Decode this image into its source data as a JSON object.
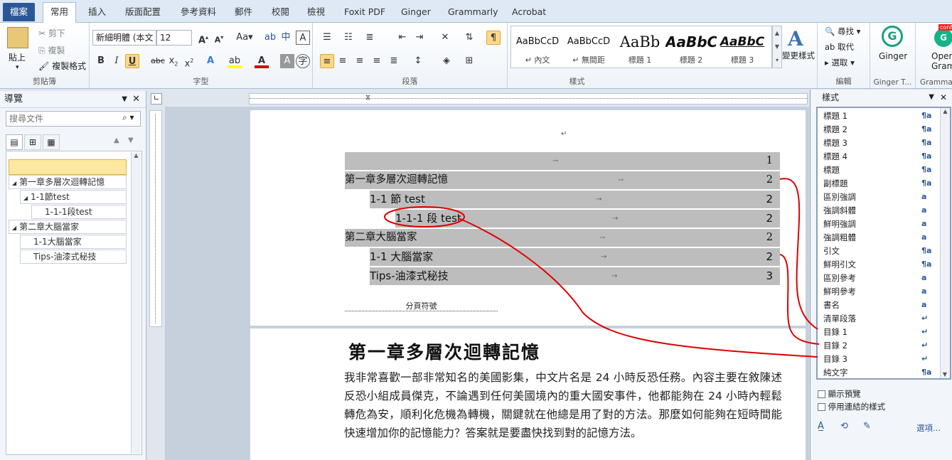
{
  "tabs": [
    "檔案",
    "常用",
    "插入",
    "版面配置",
    "參考資料",
    "郵件",
    "校閱",
    "檢視",
    "Foxit PDF",
    "Ginger",
    "Grammarly",
    "Acrobat"
  ],
  "ribbon": {
    "clipboard": {
      "paste": "貼上",
      "cut": "剪下",
      "copy": "複製",
      "format_painter": "複製格式",
      "label": "剪貼簿"
    },
    "font": {
      "name": "新細明體 (本文",
      "size": "12",
      "label": "字型"
    },
    "paragraph": {
      "label": "段落"
    },
    "styles": {
      "items": [
        {
          "preview": "AaBbCcD",
          "name": "↵ 內文"
        },
        {
          "preview": "AaBbCcD",
          "name": "↵ 無間距"
        },
        {
          "preview": "AaBb",
          "name": "標題 1"
        },
        {
          "preview": "AaBbC",
          "name": "標題 2"
        },
        {
          "preview": "AaBbC",
          "name": "標題 3"
        }
      ],
      "change": "變更樣式",
      "label": "樣式"
    },
    "editing": {
      "find": "尋找",
      "replace": "取代",
      "select": "選取",
      "label": "編輯"
    },
    "ginger": {
      "name": "Ginger",
      "label": "Ginger T..."
    },
    "grammarly": {
      "name": "Open Gramma...",
      "label": "Grammarly",
      "badge": "conf"
    }
  },
  "nav": {
    "title": "導覽",
    "search_placeholder": "搜尋文件",
    "items": [
      "第一章多層次迴轉記憶",
      "1-1節test",
      "1-1-1段test",
      "第二章大腦當家",
      "1-1大腦當家",
      "Tips-油漆式秘技"
    ]
  },
  "document": {
    "toc": [
      {
        "text": "",
        "page": "1"
      },
      {
        "text": "第一章多層次迴轉記憶",
        "page": "2"
      },
      {
        "text": "1-1 節 test",
        "page": "2"
      },
      {
        "text": "1-1-1 段 test",
        "page": "2"
      },
      {
        "text": "第二章大腦當家",
        "page": "2"
      },
      {
        "text": "1-1 大腦當家",
        "page": "2"
      },
      {
        "text": "Tips-油漆式秘技",
        "page": "3"
      }
    ],
    "page_break": "分頁符號",
    "heading": "第一章多層次迴轉記憶",
    "body": "我非常喜歡一部非常知名的美國影集，中文片名是 24 小時反恐任務。內容主要在敘陳述反恐小組成員傑克，不論遇到任何美國境內的重大國安事件，他都能夠在 24 小時內輕鬆轉危為安，順利化危機為轉機，關鍵就在他總是用了對的方法。那麼如何能夠在短時間能快速增加你的記憶能力？答案就是要盡快找到對的記憶方法。"
  },
  "styles_pane": {
    "title": "樣式",
    "items": [
      {
        "name": "標題 1",
        "mark": "¶a"
      },
      {
        "name": "標題 2",
        "mark": "¶a"
      },
      {
        "name": "標題 3",
        "mark": "¶a"
      },
      {
        "name": "標題 4",
        "mark": "¶a"
      },
      {
        "name": "標題",
        "mark": "¶a"
      },
      {
        "name": "副標題",
        "mark": "¶a"
      },
      {
        "name": "區別強調",
        "mark": "a"
      },
      {
        "name": "強調斜體",
        "mark": "a"
      },
      {
        "name": "鮮明強調",
        "mark": "a"
      },
      {
        "name": "強調粗體",
        "mark": "a"
      },
      {
        "name": "引文",
        "mark": "¶a"
      },
      {
        "name": "鮮明引文",
        "mark": "¶a"
      },
      {
        "name": "區別參考",
        "mark": "a"
      },
      {
        "name": "鮮明參考",
        "mark": "a"
      },
      {
        "name": "書名",
        "mark": "a"
      },
      {
        "name": "清單段落",
        "mark": "↵"
      },
      {
        "name": "目錄 1",
        "mark": "↵"
      },
      {
        "name": "目錄 2",
        "mark": "↵"
      },
      {
        "name": "目錄 3",
        "mark": "↵"
      },
      {
        "name": "純文字",
        "mark": "¶a"
      }
    ],
    "show_preview": "顯示預覽",
    "disable_linked": "停用連結的樣式",
    "options": "選項..."
  }
}
